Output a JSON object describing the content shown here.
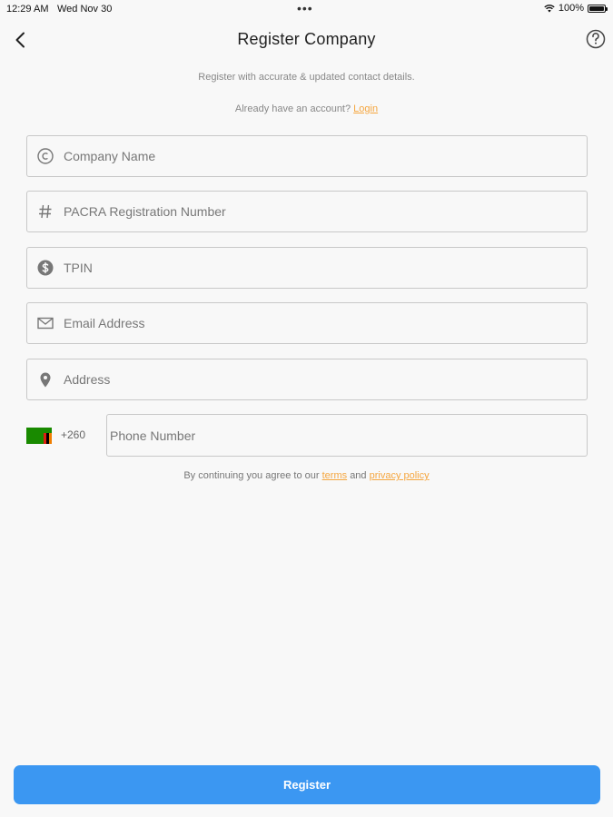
{
  "status_bar": {
    "time": "12:29 AM",
    "date": "Wed Nov 30",
    "battery": "100%",
    "battery_level": 1.0
  },
  "nav": {
    "title": "Register Company",
    "back_icon": "chevron-left-icon",
    "help_icon": "question-circle-icon"
  },
  "subtitle": "Register with accurate & updated contact details.",
  "login_prompt": {
    "text": "Already have an account?",
    "link": "Login"
  },
  "fields": {
    "company_name": {
      "placeholder": "Company Name",
      "icon": "copyright-icon",
      "value": ""
    },
    "pacra": {
      "placeholder": "PACRA Registration Number",
      "icon": "hash-icon",
      "value": ""
    },
    "tpin": {
      "placeholder": "TPIN",
      "icon": "dollar-circle-icon",
      "value": ""
    },
    "email": {
      "placeholder": "Email Address",
      "icon": "envelope-icon",
      "value": ""
    },
    "address": {
      "placeholder": "Address",
      "icon": "location-pin-icon",
      "value": ""
    }
  },
  "phone": {
    "flag": "zambia-flag-icon",
    "dial_code": "+260",
    "placeholder": "Phone Number",
    "value": ""
  },
  "terms": {
    "prefix": "By continuing you agree to our",
    "terms_link": "terms",
    "and": "and",
    "privacy_link": "privacy policy"
  },
  "register_button": "Register",
  "colors": {
    "accent": "#3b97f2",
    "link": "#f5a63f",
    "background": "#f8f8f8"
  }
}
